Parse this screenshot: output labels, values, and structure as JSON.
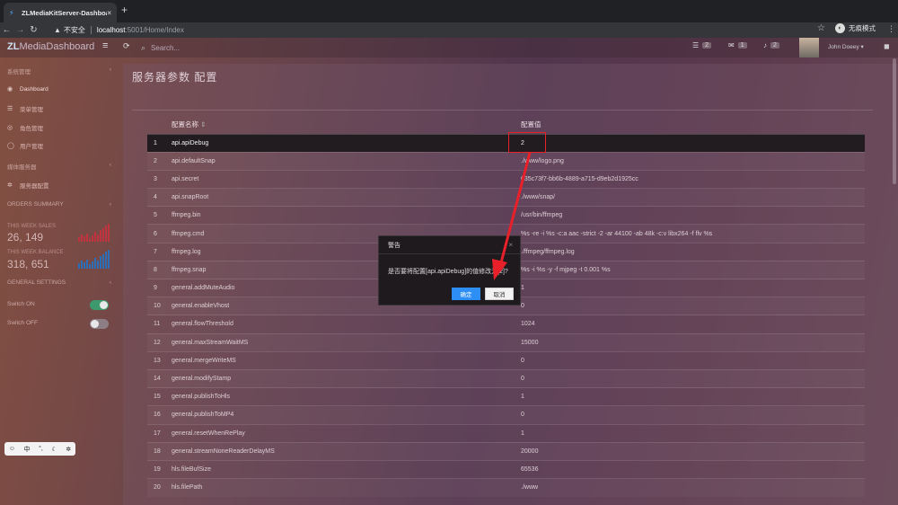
{
  "browser": {
    "tab_title": "ZLMediaKitServer-Dashboard",
    "tab_close": "×",
    "new_tab": "+",
    "security": "不安全",
    "url_host": "localhost",
    "url_path": ":5001/Home/Index",
    "incognito_label": "无痕模式"
  },
  "header": {
    "brand_zl": "ZL",
    "brand_rest": "MediaDashboard",
    "search_placeholder": "Search...",
    "tasks_count": "2",
    "messages_count": "1",
    "notifications_count": "2",
    "user_name": "John Doeey"
  },
  "sidebar": {
    "section1": "系统管理",
    "items1": [
      {
        "label": "Dashboard"
      },
      {
        "label": "菜单管理"
      },
      {
        "label": "角色管理"
      },
      {
        "label": "用户管理"
      }
    ],
    "section2": "媒体服务器",
    "items2": [
      {
        "label": "服务器配置"
      }
    ],
    "orders_summary": "ORDERS SUMMARY",
    "stat1_label": "THIS WEEK SALES",
    "stat1_value": "26, 149",
    "stat2_label": "THIS WEEK BALANCE",
    "stat2_value": "318, 651",
    "general_settings": "GENERAL SETTINGS",
    "switch_on": "Switch ON",
    "switch_off": "Switch OFF"
  },
  "main": {
    "title": "服务器参数 配置",
    "col_name": "配置名称",
    "col_value": "配置值",
    "rows": [
      {
        "n": "1",
        "k": "api.apiDebug",
        "v": "2"
      },
      {
        "n": "2",
        "k": "api.defaultSnap",
        "v": "./www/logo.png"
      },
      {
        "n": "3",
        "k": "api.secret",
        "v": "035c73f7-bb6b-4889-a715-d9eb2d1925cc"
      },
      {
        "n": "4",
        "k": "api.snapRoot",
        "v": "./www/snap/"
      },
      {
        "n": "5",
        "k": "ffmpeg.bin",
        "v": "/usr/bin/ffmpeg"
      },
      {
        "n": "6",
        "k": "ffmpeg.cmd",
        "v": "%s -re -i %s -c:a aac -strict -2 -ar 44100 -ab 48k -c:v libx264 -f flv %s"
      },
      {
        "n": "7",
        "k": "ffmpeg.log",
        "v": "./ffmpeg/ffmpeg.log"
      },
      {
        "n": "8",
        "k": "ffmpeg.snap",
        "v": "%s -i %s -y -f mjpeg -t 0.001 %s"
      },
      {
        "n": "9",
        "k": "general.addMuteAudio",
        "v": "1"
      },
      {
        "n": "10",
        "k": "general.enableVhost",
        "v": "0"
      },
      {
        "n": "11",
        "k": "general.flowThreshold",
        "v": "1024"
      },
      {
        "n": "12",
        "k": "general.maxStreamWaitMS",
        "v": "15000"
      },
      {
        "n": "13",
        "k": "general.mergeWriteMS",
        "v": "0"
      },
      {
        "n": "14",
        "k": "general.modifyStamp",
        "v": "0"
      },
      {
        "n": "15",
        "k": "general.publishToHls",
        "v": "1"
      },
      {
        "n": "16",
        "k": "general.publishToMP4",
        "v": "0"
      },
      {
        "n": "17",
        "k": "general.resetWhenRePlay",
        "v": "1"
      },
      {
        "n": "18",
        "k": "general.streamNoneReaderDelayMS",
        "v": "20000"
      },
      {
        "n": "19",
        "k": "hls.fileBufSize",
        "v": "65536"
      },
      {
        "n": "20",
        "k": "hls.filePath",
        "v": "./www"
      }
    ]
  },
  "modal": {
    "title": "警告",
    "message": "是否要将配置[api.apiDebug]的值修改为[2]?",
    "ok": "确定",
    "cancel": "取消",
    "close": "×"
  },
  "float_toolbar": {
    "lang": "中"
  },
  "colors": {
    "accent_blue": "#2d8ef5",
    "annotation_red": "#e8202a",
    "toggle_on": "#3c9a6e"
  }
}
